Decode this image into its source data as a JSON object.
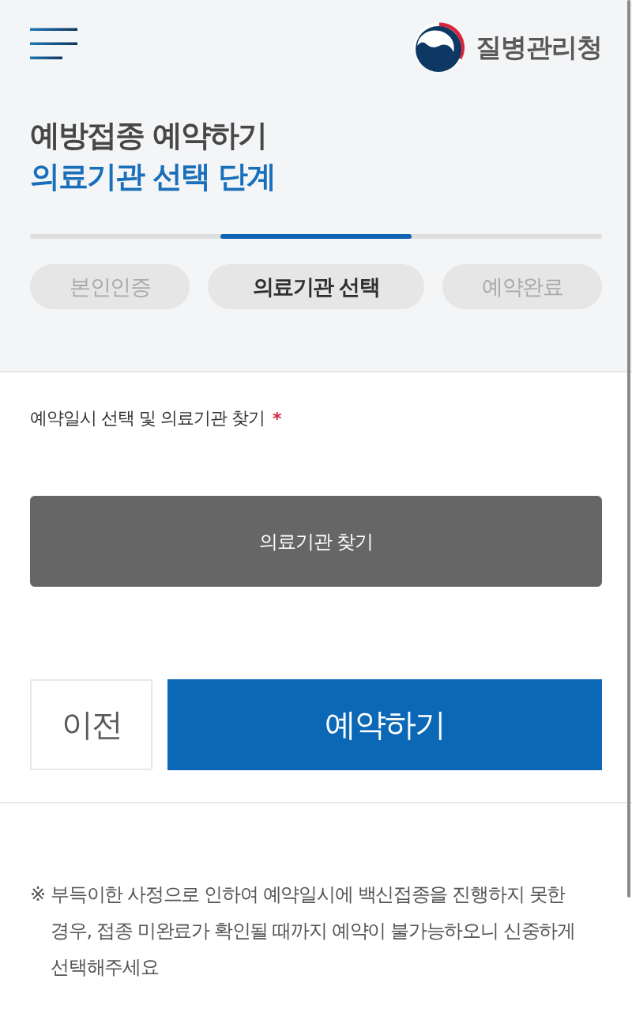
{
  "header": {
    "org_name": "질병관리청"
  },
  "title": {
    "heading": "예방접종 예약하기",
    "subheading": "의료기관 선택 단계"
  },
  "steps": [
    {
      "label": "본인인증",
      "selected": false
    },
    {
      "label": "의료기관 선택",
      "selected": true
    },
    {
      "label": "예약완료",
      "selected": false
    }
  ],
  "form": {
    "label": "예약일시 선택 및 의료기관 찾기",
    "required_mark": "*",
    "find_button": "의료기관 찾기"
  },
  "actions": {
    "back": "이전",
    "submit": "예약하기"
  },
  "notice": {
    "mark": "※",
    "text": "부득이한 사정으로 인하여 예약일시에 백신접종을 진행하지 못한 경우, 접종 미완료가 확인될 때까지 예약이 불가능하오니 신중하게 선택해주세요"
  }
}
